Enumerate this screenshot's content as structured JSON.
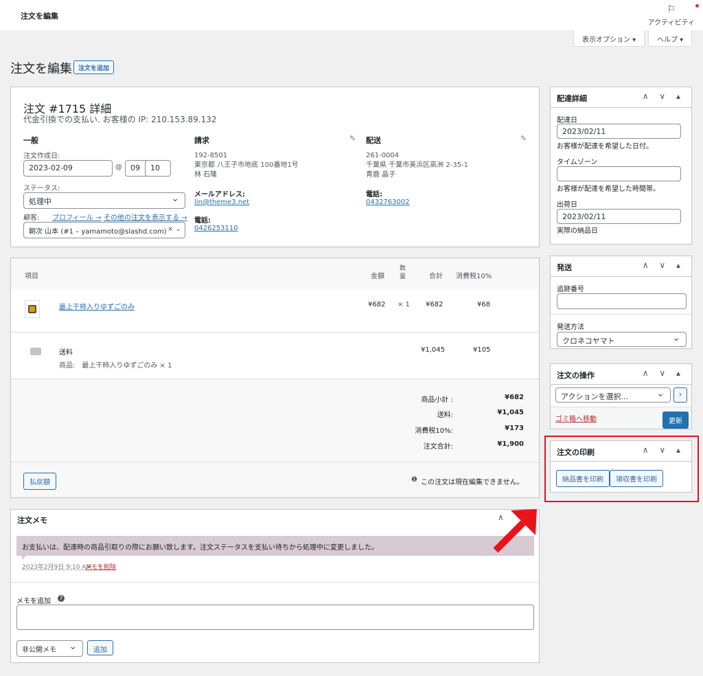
{
  "topbar": {
    "title": "注文を編集",
    "activity_label": "アクティビティ"
  },
  "screen_options": {
    "display_options": "表示オプション ▾",
    "help": "ヘルプ ▾"
  },
  "page": {
    "title": "注文を編集",
    "add_order": "注文を追加"
  },
  "order": {
    "heading": "注文 #1715 詳細",
    "subheading": "代金引換での支払い. お客様の IP: 210.153.89.132",
    "general": {
      "title": "一般",
      "created_label": "注文作成日:",
      "date": "2023-02-09",
      "at": "@",
      "hour": "09",
      "colon": ":",
      "minute": "10",
      "status_label": "ステータス:",
      "status": "処理中",
      "customer_label": "顧客:",
      "profile_link": "プロフィール →",
      "other_orders_link": "その他の注文を表示する →",
      "customer": "朝次 山本 (#1 – yamamoto@slashd.com)",
      "clear": "× ⌄"
    },
    "billing": {
      "title": "請求",
      "postal": "192-8501",
      "address": "東京都 八王子市地底 100番地1号",
      "name": "林 石隆",
      "email_label": "メールアドレス:",
      "email": "lin@theme3.net",
      "phone_label": "電話:",
      "phone": "0426253110"
    },
    "shipping": {
      "title": "配送",
      "postal": "261-0004",
      "address": "千葉県 千葉市美浜区高洲 2-35-1",
      "name": "青鹿 晶子",
      "phone_label": "電話:",
      "phone": "0432763002"
    }
  },
  "items": {
    "headers": {
      "item": "項目",
      "price": "金額",
      "qty": "数量",
      "total": "合計",
      "tax": "消費税10%"
    },
    "rows": [
      {
        "name": "最上干柿入りゆずごのみ",
        "price": "¥682",
        "qty": "× 1",
        "total": "¥682",
        "tax": "¥68"
      }
    ],
    "shipping_row": {
      "label": "送料",
      "detail": "商品:　最上干柿入りゆずごのみ × 1",
      "total": "¥1,045",
      "tax": "¥105"
    },
    "totals": [
      {
        "label": "商品小計 :",
        "value": "¥682"
      },
      {
        "label": "送料:",
        "value": "¥1,045"
      },
      {
        "label": "消費税10%:",
        "value": "¥173"
      },
      {
        "label": "注文合計:",
        "value": "¥1,900"
      }
    ],
    "refund_button": "払戻額",
    "not_editable": "この注文は現在編集できません。"
  },
  "notes": {
    "title": "注文メモ",
    "note_text": "お支払いは、配達時の商品引取りの際にお願い致します。注文ステータスを支払い待ちから処理中に変更しました。",
    "note_meta": "2023年2月9日 9:10 AM",
    "delete_link": "メモを削除",
    "add_label": "メモを追加",
    "help_icon": "?",
    "type": "非公開メモ",
    "add_button": "追加"
  },
  "delivery": {
    "title": "配達詳細",
    "date_label": "配達日",
    "date": "2023/02/11",
    "date_help": "お客様が配達を希望した日付。",
    "timezone_label": "タイムゾーン",
    "timezone": "",
    "timezone_help": "お客様が配達を希望した時間帯。",
    "ship_label": "出荷日",
    "ship_date": "2023/02/11",
    "ship_help": "実際の納品日"
  },
  "shipment": {
    "title": "発送",
    "tracking_label": "追跡番号",
    "tracking": "",
    "method_label": "発送方法",
    "method": "クロネコヤマト"
  },
  "actions": {
    "title": "注文の操作",
    "select": "アクションを選択...",
    "go": "›",
    "trash": "ゴミ箱へ移動",
    "update": "更新"
  },
  "print": {
    "title": "注文の印刷",
    "invoice": "納品書を印刷",
    "receipt": "領収書を印刷"
  },
  "colors": {
    "accent": "#2271b1",
    "highlight_border": "#e0141e",
    "arrow": "#e8141c",
    "note_bg": "#d7cad2"
  },
  "box_controls": "∧ ∨ ▴"
}
